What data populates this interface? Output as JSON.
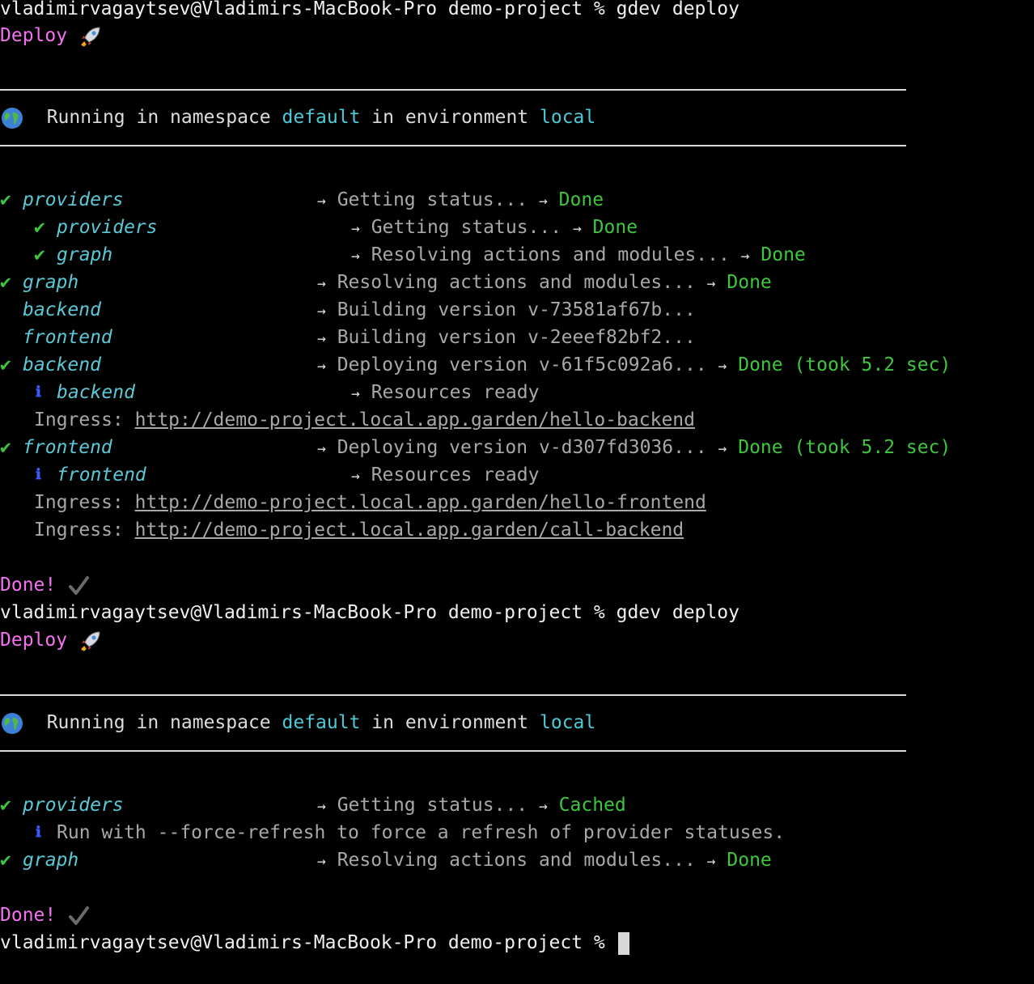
{
  "terminal": {
    "prompt": "vladimirvagaytsev@Vladimirs-MacBook-Pro demo-project % ",
    "command": "gdev deploy",
    "deploy_label": "Deploy",
    "rocket_icon": "rocket-icon",
    "globe_icon": "globe-icon",
    "namespace_prefix": "Running in namespace ",
    "namespace": "default",
    "env_prefix": " in environment ",
    "environment": "local",
    "done_label": "Done!",
    "check_icon": "check-mark-icon",
    "arrow": "→",
    "check": "✔",
    "info": "ℹ",
    "ingress_label": "Ingress: "
  },
  "run1": {
    "rows": [
      {
        "check": "✔",
        "name": "providers",
        "msg": "Getting status... ",
        "status": "Done"
      },
      {
        "check": "✔",
        "name": "providers",
        "msg": "Getting status... ",
        "status": "Done"
      },
      {
        "check": "✔",
        "name": "graph",
        "msg": "Resolving actions and modules... ",
        "status": "Done"
      },
      {
        "check": "✔",
        "name": "graph",
        "msg": "Resolving actions and modules... ",
        "status": "Done"
      },
      {
        "name": "backend",
        "msg": "Building version v-73581af67b..."
      },
      {
        "name": "frontend",
        "msg": "Building version v-2eeef82bf2..."
      },
      {
        "check": "✔",
        "name": "backend",
        "msg": "Deploying version v-61f5c092a6... ",
        "status": "Done (took 5.2 sec)"
      },
      {
        "info": "ℹ",
        "name": "backend",
        "msg": "Resources ready"
      },
      {
        "url": "http://demo-project.local.app.garden/hello-backend"
      },
      {
        "check": "✔",
        "name": "frontend",
        "msg": "Deploying version v-d307fd3036... ",
        "status": "Done (took 5.2 sec)"
      },
      {
        "info": "ℹ",
        "name": "frontend",
        "msg": "Resources ready"
      },
      {
        "url": "http://demo-project.local.app.garden/hello-frontend"
      },
      {
        "url": "http://demo-project.local.app.garden/call-backend"
      }
    ]
  },
  "run2": {
    "rows": [
      {
        "check": "✔",
        "name": "providers",
        "msg": "Getting status... ",
        "status": "Cached"
      },
      {
        "info": "ℹ",
        "msg": "Run with --force-refresh to force a refresh of provider statuses."
      },
      {
        "check": "✔",
        "name": "graph",
        "msg": "Resolving actions and modules... ",
        "status": "Done"
      }
    ]
  }
}
